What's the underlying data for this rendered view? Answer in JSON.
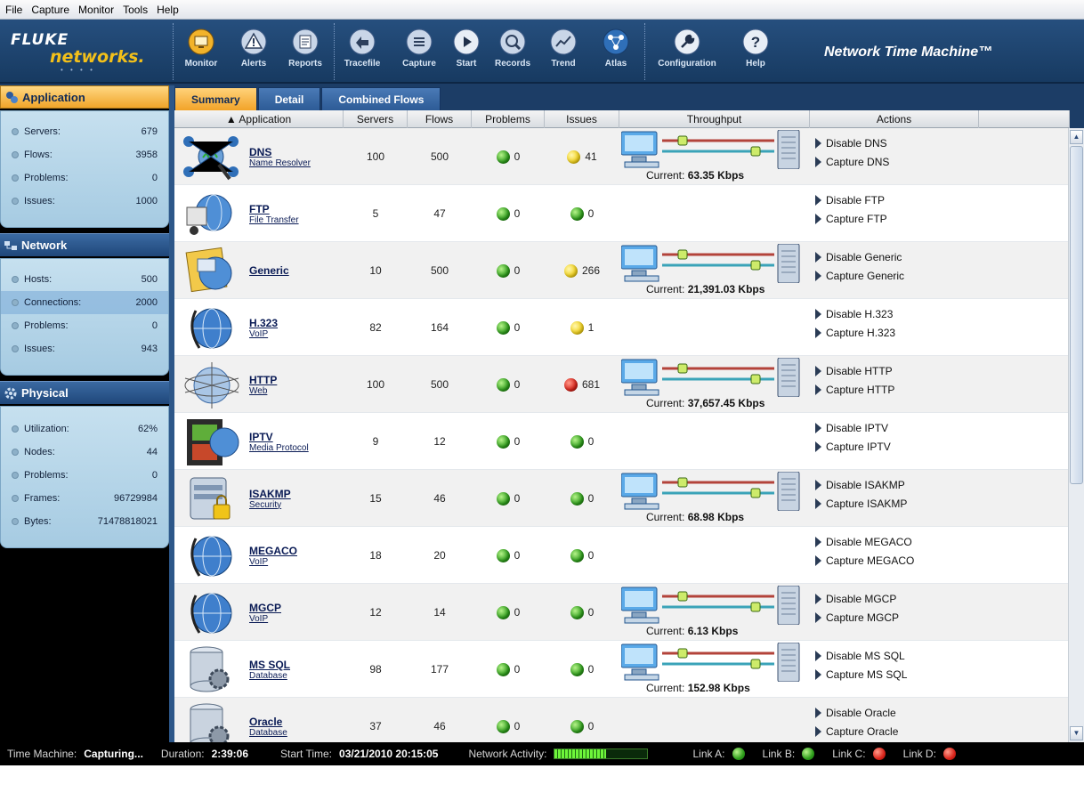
{
  "menubar": [
    "File",
    "Capture",
    "Monitor",
    "Tools",
    "Help"
  ],
  "logo": {
    "line1": "FLUKE",
    "line2": "networks."
  },
  "product_title": "Network Time Machine™",
  "toolbar": [
    {
      "label": "Monitor",
      "icon": "monitor-icon"
    },
    {
      "label": "Alerts",
      "icon": "alert-icon"
    },
    {
      "label": "Reports",
      "icon": "reports-icon"
    },
    {
      "label": "Tracefile",
      "icon": "tracefile-icon"
    },
    {
      "label": "Capture",
      "icon": "capture-icon"
    },
    {
      "label": "Start",
      "icon": "play-icon"
    },
    {
      "label": "Records",
      "icon": "records-icon"
    },
    {
      "label": "Trend",
      "icon": "trend-icon"
    },
    {
      "label": "Atlas",
      "icon": "atlas-icon"
    },
    {
      "label": "Configuration",
      "icon": "wrench-icon"
    },
    {
      "label": "Help",
      "icon": "help-icon"
    }
  ],
  "sidebar": {
    "application": {
      "title": "Application",
      "stats": [
        {
          "label": "Servers:",
          "value": "679"
        },
        {
          "label": "Flows:",
          "value": "3958"
        },
        {
          "label": "Problems:",
          "value": "0"
        },
        {
          "label": "Issues:",
          "value": "1000"
        }
      ]
    },
    "network": {
      "title": "Network",
      "stats": [
        {
          "label": "Hosts:",
          "value": "500"
        },
        {
          "label": "Connections:",
          "value": "2000"
        },
        {
          "label": "Problems:",
          "value": "0"
        },
        {
          "label": "Issues:",
          "value": "943"
        }
      ]
    },
    "physical": {
      "title": "Physical",
      "stats": [
        {
          "label": "Utilization:",
          "value": "62%"
        },
        {
          "label": "Nodes:",
          "value": "44"
        },
        {
          "label": "Problems:",
          "value": "0"
        },
        {
          "label": "Frames:",
          "value": "96729984"
        },
        {
          "label": "Bytes:",
          "value": "71478818021"
        }
      ]
    }
  },
  "tabs": [
    "Summary",
    "Detail",
    "Combined Flows"
  ],
  "table": {
    "headers": [
      "▲ Application",
      "Servers",
      "Flows",
      "Problems",
      "Issues",
      "Throughput",
      "Actions"
    ],
    "rows": [
      {
        "name": "DNS",
        "sub": "Name Resolver",
        "icon": "dns-network-icon",
        "servers": "100",
        "flows": "500",
        "problems": "0",
        "problems_status": "green",
        "issues": "41",
        "issues_status": "yellow",
        "throughput_label": "Current:",
        "throughput": "63.35 Kbps",
        "actions": [
          "Disable DNS",
          "Capture DNS"
        ]
      },
      {
        "name": "FTP",
        "sub": "File Transfer",
        "icon": "ftp-globe-icon",
        "servers": "5",
        "flows": "47",
        "problems": "0",
        "problems_status": "green",
        "issues": "0",
        "issues_status": "green",
        "throughput_label": "",
        "throughput": "",
        "actions": [
          "Disable FTP",
          "Capture FTP"
        ]
      },
      {
        "name": "Generic",
        "sub": "",
        "icon": "generic-envelope-icon",
        "servers": "10",
        "flows": "500",
        "problems": "0",
        "problems_status": "green",
        "issues": "266",
        "issues_status": "yellow",
        "throughput_label": "Current:",
        "throughput": "21,391.03 Kbps",
        "actions": [
          "Disable Generic",
          "Capture Generic"
        ]
      },
      {
        "name": "H.323",
        "sub": "VoIP",
        "icon": "voip-globe-icon",
        "servers": "82",
        "flows": "164",
        "problems": "0",
        "problems_status": "green",
        "issues": "1",
        "issues_status": "yellow",
        "throughput_label": "",
        "throughput": "",
        "actions": [
          "Disable H.323",
          "Capture H.323"
        ]
      },
      {
        "name": "HTTP",
        "sub": "Web",
        "icon": "web-globe-icon",
        "servers": "100",
        "flows": "500",
        "problems": "0",
        "problems_status": "green",
        "issues": "681",
        "issues_status": "red",
        "throughput_label": "Current:",
        "throughput": "37,657.45 Kbps",
        "actions": [
          "Disable HTTP",
          "Capture HTTP"
        ]
      },
      {
        "name": "IPTV",
        "sub": "Media Protocol",
        "icon": "film-icon",
        "servers": "9",
        "flows": "12",
        "problems": "0",
        "problems_status": "green",
        "issues": "0",
        "issues_status": "green",
        "throughput_label": "",
        "throughput": "",
        "actions": [
          "Disable IPTV",
          "Capture IPTV"
        ]
      },
      {
        "name": "ISAKMP",
        "sub": "Security",
        "icon": "server-lock-icon",
        "servers": "15",
        "flows": "46",
        "problems": "0",
        "problems_status": "green",
        "issues": "0",
        "issues_status": "green",
        "throughput_label": "Current:",
        "throughput": "68.98 Kbps",
        "actions": [
          "Disable ISAKMP",
          "Capture ISAKMP"
        ]
      },
      {
        "name": "MEGACO",
        "sub": "VoIP",
        "icon": "voip-globe-icon",
        "servers": "18",
        "flows": "20",
        "problems": "0",
        "problems_status": "green",
        "issues": "0",
        "issues_status": "green",
        "throughput_label": "",
        "throughput": "",
        "actions": [
          "Disable MEGACO",
          "Capture MEGACO"
        ]
      },
      {
        "name": "MGCP",
        "sub": "VoIP",
        "icon": "voip-globe-icon",
        "servers": "12",
        "flows": "14",
        "problems": "0",
        "problems_status": "green",
        "issues": "0",
        "issues_status": "green",
        "throughput_label": "Current:",
        "throughput": "6.13 Kbps",
        "actions": [
          "Disable MGCP",
          "Capture MGCP"
        ]
      },
      {
        "name": "MS SQL",
        "sub": "Database",
        "icon": "database-gear-icon",
        "servers": "98",
        "flows": "177",
        "problems": "0",
        "problems_status": "green",
        "issues": "0",
        "issues_status": "green",
        "throughput_label": "Current:",
        "throughput": "152.98 Kbps",
        "actions": [
          "Disable MS SQL",
          "Capture MS SQL"
        ]
      },
      {
        "name": "Oracle",
        "sub": "Database",
        "icon": "database-gear-icon",
        "servers": "37",
        "flows": "46",
        "problems": "0",
        "problems_status": "green",
        "issues": "0",
        "issues_status": "green",
        "throughput_label": "",
        "throughput": "",
        "actions": [
          "Disable Oracle",
          "Capture Oracle"
        ]
      }
    ]
  },
  "statusbar": {
    "time_machine_label": "Time Machine:",
    "time_machine_value": "Capturing...",
    "duration_label": "Duration:",
    "duration_value": "2:39:06",
    "start_time_label": "Start Time:",
    "start_time_value": "03/21/2010 20:15:05",
    "network_activity_label": "Network Activity:",
    "network_activity_level": 0.55,
    "links": [
      {
        "label": "Link A:",
        "status": "green"
      },
      {
        "label": "Link B:",
        "status": "green"
      },
      {
        "label": "Link C:",
        "status": "red"
      },
      {
        "label": "Link D:",
        "status": "red"
      }
    ]
  },
  "colors": {
    "accent": "#f2a328",
    "toolbar": "#1c3d66",
    "green": "#2c9c1a",
    "yellow": "#f2d21b",
    "red": "#d8231a"
  }
}
